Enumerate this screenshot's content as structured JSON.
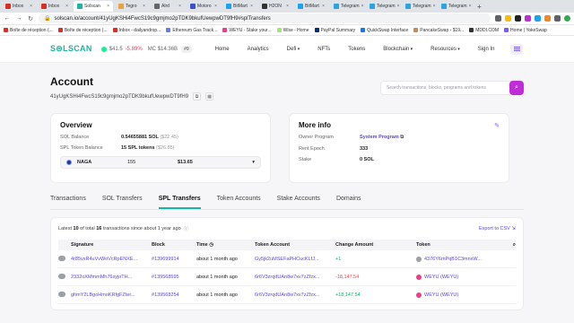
{
  "browser": {
    "tabs": [
      {
        "label": "Inbox",
        "color": "#d93025"
      },
      {
        "label": "Inbox",
        "color": "#d93025"
      },
      {
        "label": "Solscan",
        "color": "#19b6a3",
        "active": true
      },
      {
        "label": "Tegro",
        "color": "#e8a33d"
      },
      {
        "label": "Alrd",
        "color": "#666666"
      },
      {
        "label": "Motoro",
        "color": "#3c4fd1"
      },
      {
        "label": "BitMart",
        "color": "#1da1f2"
      },
      {
        "label": "H2ON",
        "color": "#333333"
      },
      {
        "label": "BitMart",
        "color": "#1da1f2"
      },
      {
        "label": "Telegram",
        "color": "#2aa3df"
      },
      {
        "label": "Telegram",
        "color": "#2aa3df"
      },
      {
        "label": "Telegram",
        "color": "#2aa3df"
      },
      {
        "label": "Telegram",
        "color": "#2aa3df"
      }
    ],
    "url": "solscan.io/account/41yUgKSHi4FwcS19c9gmjmo2pTDK9bkufUewpwDT9fH9#splTransfers",
    "bookmarks": [
      {
        "label": "Boîte de réception (...",
        "color": "#d93025"
      },
      {
        "label": "Boîte de réception (...",
        "color": "#d93025"
      },
      {
        "label": "Inbox - dailyandrop...",
        "color": "#d93025"
      },
      {
        "label": "Ethereum Gas Track...",
        "color": "#627eea"
      },
      {
        "label": "WEYU - Stake your...",
        "color": "#e83e8c"
      },
      {
        "label": "Wise - Home",
        "color": "#9fe870"
      },
      {
        "label": "PayPal Summary",
        "color": "#003087"
      },
      {
        "label": "QuickSwap Interface",
        "color": "#2172e5"
      },
      {
        "label": "PancakeSwap - $19...",
        "color": "#d1884f"
      },
      {
        "label": "MDDI.COM",
        "color": "#333333"
      },
      {
        "label": "Home | YokeSwap",
        "color": "#7a5cf5"
      }
    ]
  },
  "header": {
    "logo": "S⊜LSCAN",
    "sol_price": "$41.5",
    "sol_change": "-5.89%",
    "mc_label": "MC",
    "mc_value": "$14.36B",
    "rank": "#9",
    "nav": [
      {
        "label": "Home",
        "caret": false
      },
      {
        "label": "Analytics",
        "caret": false
      },
      {
        "label": "Defi",
        "caret": true
      },
      {
        "label": "NFTs",
        "caret": false
      },
      {
        "label": "Tokens",
        "caret": false
      },
      {
        "label": "Blockchain",
        "caret": true
      },
      {
        "label": "Resources",
        "caret": true
      },
      {
        "label": "Sign In",
        "caret": false
      }
    ]
  },
  "account": {
    "title": "Account",
    "address": "41yUgKSHi4FwcS19c9gmjmo2pTDK9bkufUewpwDT9fH9"
  },
  "search": {
    "placeholder": "Search transactions, blocks, programs and tokens"
  },
  "overview": {
    "title": "Overview",
    "sol_balance_label": "SOL Balance",
    "sol_balance_value": "0.54655881 SOL",
    "sol_balance_usd": "($22.45)",
    "spl_label": "SPL Token Balance",
    "spl_value": "15 SPL tokens",
    "spl_usd": "($26.85)",
    "token_name": "NAGA",
    "token_amount": "155",
    "token_usd": "$13.65"
  },
  "more_info": {
    "title": "More info",
    "owner_label": "Owner Program",
    "owner_value": "System Program",
    "rent_label": "Rent Epoch",
    "rent_value": "333",
    "stake_label": "Stake",
    "stake_value": "0 SOL"
  },
  "tabs": [
    "Transactions",
    "SOL Transfers",
    "SPL Transfers",
    "Token Accounts",
    "Stake Accounts",
    "Domains"
  ],
  "tx": {
    "summary_prefix": "Latest",
    "summary_count": "10",
    "summary_mid": "of total",
    "summary_total": "16",
    "summary_suffix": "transactions since about 1 year ago",
    "export": "Export to CSV",
    "columns": [
      "Signature",
      "Block",
      "Time",
      "Token Account",
      "Change Amount",
      "Token"
    ],
    "rows": [
      {
        "signature": "4r85vxR4uVvWoVcRpENXE...",
        "block": "#139699914",
        "time": "about 1 month ago",
        "account": "Gy5jk2uMSEFaPHCucKLfJ...",
        "change": "+1",
        "sign": "pos",
        "token": "4376Y6mPqB1C3mnxW...",
        "token_color": "#9aa0a6"
      },
      {
        "signature": "2332oXMmmMh76syjoTH...",
        "block": "#139568595",
        "time": "about 1 month ago",
        "account": "6r6V3zrqdUAn8w7xv7zZfzx...",
        "change": "-18,147.54",
        "sign": "neg",
        "token": "WEYU (WEYU)",
        "token_color": "#e83e8c"
      },
      {
        "signature": "ghmY2LBgoHmoKRfgFZter...",
        "block": "#139568254",
        "time": "about 1 month ago",
        "account": "6r6V3zrqdUAn8w7xv7zZfzx...",
        "change": "+18,147.54",
        "sign": "pos",
        "token": "WEYU (WEYU)",
        "token_color": "#e83e8c"
      }
    ]
  }
}
